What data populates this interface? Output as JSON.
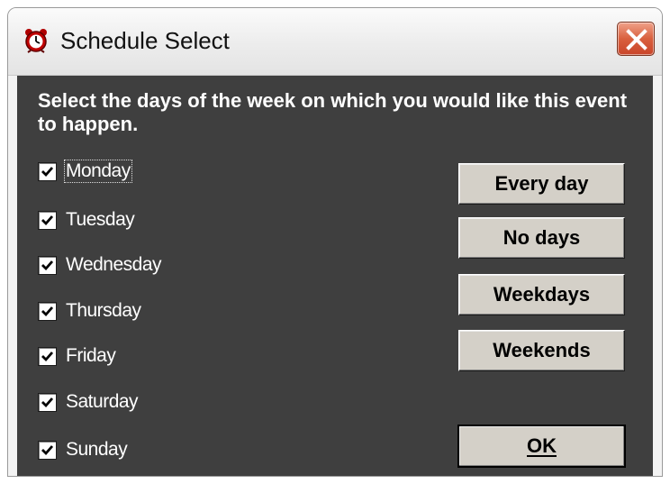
{
  "window": {
    "title": "Schedule Select",
    "icon": "alarm-clock-icon"
  },
  "instructions": "Select the days of the week on which you would like this event to happen.",
  "days": [
    {
      "label": "Monday",
      "checked": true
    },
    {
      "label": "Tuesday",
      "checked": true
    },
    {
      "label": "Wednesday",
      "checked": true
    },
    {
      "label": "Thursday",
      "checked": true
    },
    {
      "label": "Friday",
      "checked": true
    },
    {
      "label": "Saturday",
      "checked": true
    },
    {
      "label": "Sunday",
      "checked": true
    }
  ],
  "buttons": {
    "every_day": "Every day",
    "no_days": "No days",
    "weekdays": "Weekdays",
    "weekends": "Weekends",
    "ok": "OK"
  },
  "colors": {
    "dialog_background": "#3f3f3f",
    "close_button": "#d9603e",
    "button_face": "#d4d0c8"
  }
}
